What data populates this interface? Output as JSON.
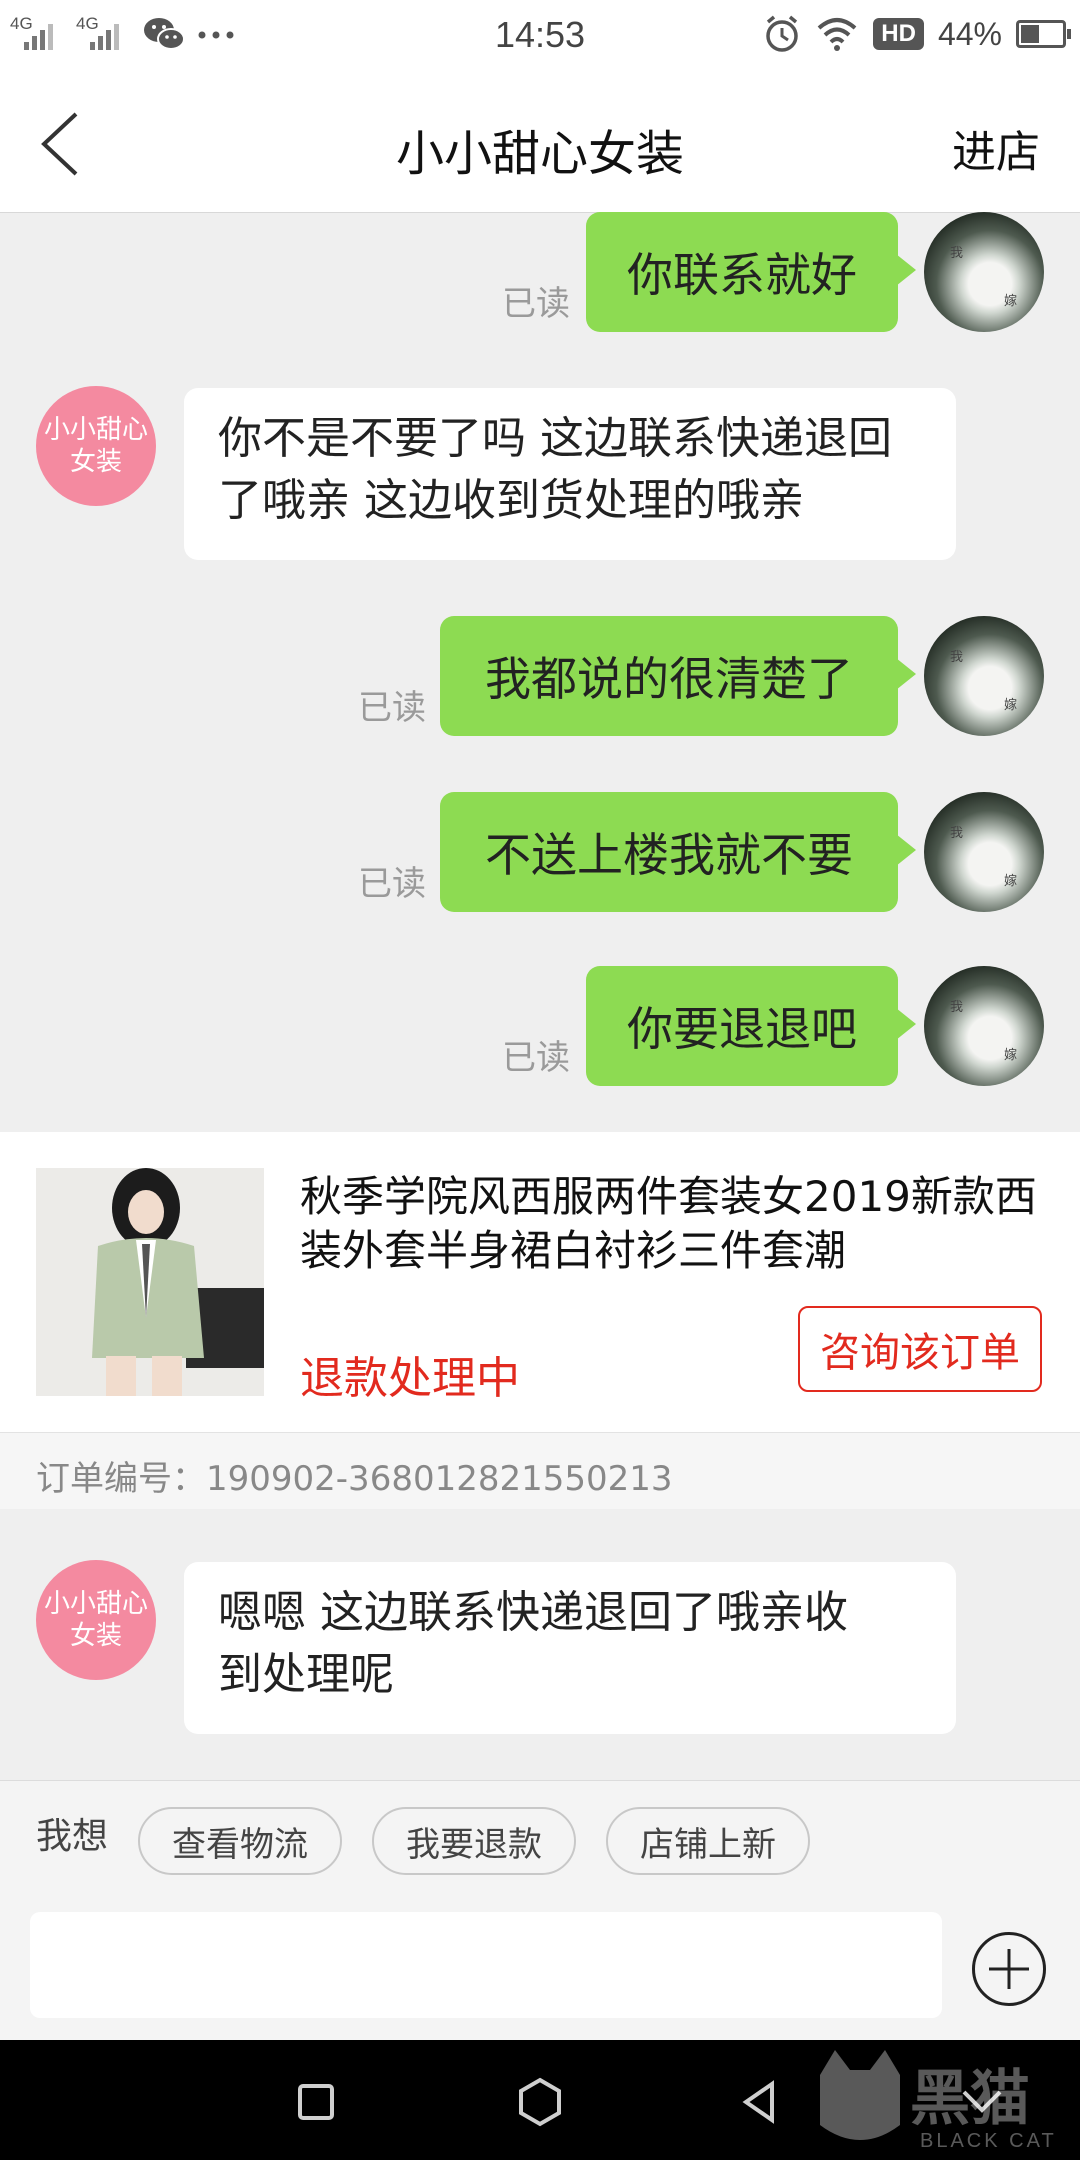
{
  "status_bar": {
    "network_left": "4G",
    "network_right": "4G",
    "time": "14:53",
    "hd_badge": "HD",
    "battery_percent": "44%",
    "battery_level": 0.44,
    "icons": [
      "signal-icon",
      "wechat-icon",
      "more-dots-icon",
      "alarm-icon",
      "wifi-icon",
      "battery-icon"
    ]
  },
  "header": {
    "title": "小小甜心女装",
    "enter_shop": "进店"
  },
  "shop_avatar_text": "小小甜心\n女装",
  "read_label": "已读",
  "messages": [
    {
      "from": "me",
      "text": "你联系就好",
      "read": true
    },
    {
      "from": "shop",
      "text": "你不是不要了吗  这边联系快递退回了哦亲  这边收到货处理的哦亲"
    },
    {
      "from": "me",
      "text": "我都说的很清楚了",
      "read": true
    },
    {
      "from": "me",
      "text": "不送上楼我就不要",
      "read": true
    },
    {
      "from": "me",
      "text": "你要退退吧",
      "read": true
    },
    {
      "from": "shop",
      "text": "嗯嗯  这边联系快递退回了哦亲收到处理呢"
    }
  ],
  "order": {
    "product_title": "秋季学院风西服两件套装女2019新款西装外套半身裙白衬衫三件套潮",
    "status": "退款处理中",
    "consult_button": "咨询该订单",
    "order_number": "订单编号：190902-368012821550213"
  },
  "quick_actions": {
    "label": "我想",
    "chips": [
      "查看物流",
      "我要退款",
      "店铺上新"
    ]
  },
  "input": {
    "value": "",
    "placeholder": ""
  },
  "watermark": {
    "logo_text": "黑猫",
    "sub_text": "BLACK CAT"
  }
}
